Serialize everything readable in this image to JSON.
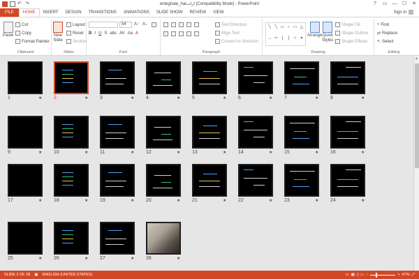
{
  "window": {
    "title": "enteghale_harارات [Compatibility Mode] - PowerPoint",
    "controls": [
      "?",
      "▭",
      "—",
      "☐",
      "✕"
    ]
  },
  "tabs": [
    {
      "label": "FILE",
      "id": "file"
    },
    {
      "label": "HOME",
      "id": "home"
    },
    {
      "label": "INSERT",
      "id": "insert"
    },
    {
      "label": "DESIGN",
      "id": "design"
    },
    {
      "label": "TRANSITIONS",
      "id": "transitions"
    },
    {
      "label": "ANIMATIONS",
      "id": "animations"
    },
    {
      "label": "SLIDE SHOW",
      "id": "slideshow"
    },
    {
      "label": "REVIEW",
      "id": "review"
    },
    {
      "label": "VIEW",
      "id": "view"
    }
  ],
  "signin": "Sign in",
  "ribbon": {
    "clipboard": {
      "label": "Clipboard",
      "paste": "Paste",
      "cut": "Cut",
      "copy": "Copy",
      "format_painter": "Format Painter"
    },
    "slides": {
      "label": "Slides",
      "new_slide": "New",
      "new_slide2": "Slide",
      "layout": "Layout",
      "reset": "Reset",
      "section": "Section"
    },
    "font": {
      "label": "Font",
      "size": "54"
    },
    "paragraph": {
      "label": "Paragraph",
      "text_direction": "Text Direction",
      "align_text": "Align Text",
      "convert": "Convert to SmartArt"
    },
    "drawing": {
      "label": "Drawing",
      "arrange": "Arrange",
      "quick_styles": "Quick",
      "quick_styles2": "Styles",
      "shape_fill": "Shape Fill",
      "shape_outline": "Shape Outline",
      "shape_effects": "Shape Effects"
    },
    "editing": {
      "label": "Editing",
      "find": "Find",
      "replace": "Replace",
      "select": "Select"
    }
  },
  "slides": [
    {
      "num": "1"
    },
    {
      "num": "2",
      "selected": true
    },
    {
      "num": "3"
    },
    {
      "num": "4"
    },
    {
      "num": "5"
    },
    {
      "num": "6"
    },
    {
      "num": "7"
    },
    {
      "num": "8"
    },
    {
      "num": "9"
    },
    {
      "num": "10"
    },
    {
      "num": "11"
    },
    {
      "num": "12"
    },
    {
      "num": "13"
    },
    {
      "num": "14"
    },
    {
      "num": "15"
    },
    {
      "num": "16"
    },
    {
      "num": "17"
    },
    {
      "num": "18"
    },
    {
      "num": "19"
    },
    {
      "num": "20"
    },
    {
      "num": "21"
    },
    {
      "num": "22"
    },
    {
      "num": "23"
    },
    {
      "num": "24"
    },
    {
      "num": "25"
    },
    {
      "num": "26"
    },
    {
      "num": "27"
    },
    {
      "num": "28",
      "photo": true
    }
  ],
  "star": "★",
  "status": {
    "slide": "SLIDE 2 OF 28",
    "language": "ENGLISH (UNITED STATES)",
    "zoom": "47%",
    "zoom_fraction": 0.47
  },
  "colors": {
    "accent": "#d24726"
  }
}
